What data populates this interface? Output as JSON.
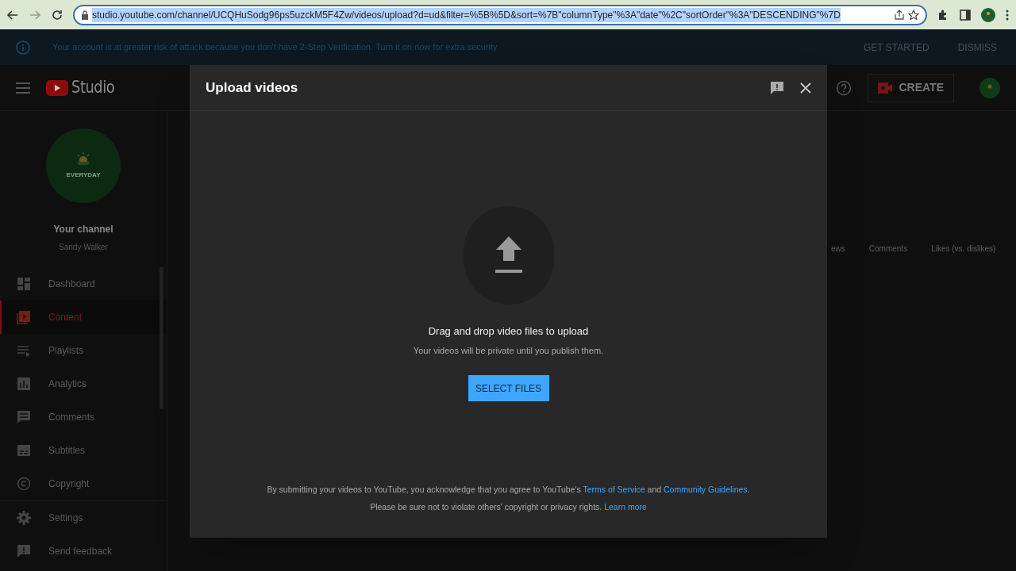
{
  "browser": {
    "url": "studio.youtube.com/channel/UCQHuSodg96ps5uzckM5F4Zw/videos/upload?d=ud&filter=%5B%5D&sort=%7B\"columnType\"%3A\"date\"%2C\"sortOrder\"%3A\"DESCENDING\"%7D"
  },
  "alert": {
    "message": "Your account is at greater risk of attack because you don't have 2-Step Verification. Turn it on now for extra security",
    "actions": [
      "GET STARTED",
      "DISMISS"
    ]
  },
  "header": {
    "logo": "Studio",
    "create": "CREATE"
  },
  "channel": {
    "avatar_text": "EVERYDAY",
    "title": "Your channel",
    "name": "Sandy Walker"
  },
  "sidebar": {
    "items": [
      {
        "kind": "dashboard",
        "label": "Dashboard",
        "selected": false
      },
      {
        "kind": "content",
        "label": "Content",
        "selected": true
      },
      {
        "kind": "playlists",
        "label": "Playlists",
        "selected": false
      },
      {
        "kind": "analytics",
        "label": "Analytics",
        "selected": false
      },
      {
        "kind": "comments",
        "label": "Comments",
        "selected": false
      },
      {
        "kind": "subtitles",
        "label": "Subtitles",
        "selected": false
      },
      {
        "kind": "copyright",
        "label": "Copyright",
        "selected": false
      }
    ],
    "bottom": [
      {
        "kind": "settings",
        "label": "Settings"
      },
      {
        "kind": "feedback",
        "label": "Send feedback"
      }
    ]
  },
  "table": {
    "columns": [
      "ews",
      "Comments",
      "Likes (vs. dislikes)"
    ]
  },
  "dialog": {
    "title": "Upload videos",
    "heading": "Drag and drop video files to upload",
    "subtext": "Your videos will be private until you publish them.",
    "button": "SELECT FILES",
    "footer": [
      [
        {
          "kind": "text",
          "text": "By submitting your videos to YouTube, you acknowledge that you agree to YouTube's "
        },
        {
          "kind": "link",
          "text": "Terms of Service"
        },
        {
          "kind": "text",
          "text": " and "
        },
        {
          "kind": "link",
          "text": "Community Guidelines"
        },
        {
          "kind": "text",
          "text": "."
        }
      ],
      [
        {
          "kind": "text",
          "text": "Please be sure not to violate others' copyright or privacy rights. "
        },
        {
          "kind": "link",
          "text": "Learn more"
        }
      ]
    ]
  }
}
